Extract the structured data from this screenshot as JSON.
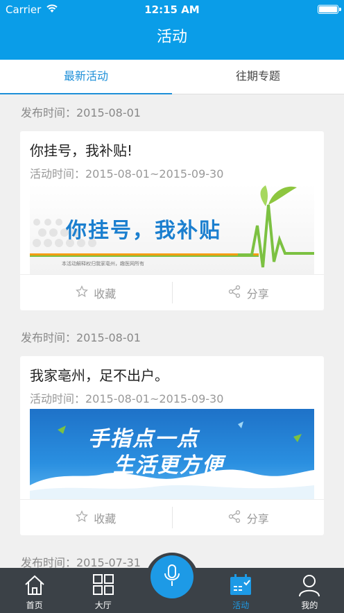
{
  "status": {
    "carrier": "Carrier",
    "time": "12:15 AM"
  },
  "nav": {
    "title": "活动"
  },
  "tabs": [
    {
      "label": "最新活动",
      "active": true
    },
    {
      "label": "往期专题",
      "active": false
    }
  ],
  "feed": [
    {
      "date": "发布时间：2015-08-01",
      "title": "你挂号，我补贴!",
      "time": "活动时间：2015-08-01~2015-09-30",
      "banner": {
        "headline": "你挂号，我补贴",
        "footnote": "本活动解释权归我家亳州，趣医网所有"
      },
      "favorite": "收藏",
      "share": "分享"
    },
    {
      "date": "发布时间：2015-08-01",
      "title": "我家亳州，足不出户。",
      "time": "活动时间：2015-08-01~2015-09-30",
      "banner": {
        "line1": "手指点一点",
        "line2": "生活更方便"
      },
      "favorite": "收藏",
      "share": "分享"
    },
    {
      "date": "发布时间：2015-07-31"
    }
  ],
  "tabbar": [
    {
      "label": "首页",
      "icon": "home-icon",
      "active": false
    },
    {
      "label": "大厅",
      "icon": "grid-icon",
      "active": false
    },
    {
      "label": "",
      "icon": "microphone-icon",
      "active": false
    },
    {
      "label": "活动",
      "icon": "calendar-icon",
      "active": true
    },
    {
      "label": "我的",
      "icon": "user-icon",
      "active": false
    }
  ],
  "colors": {
    "primary": "#0a9de8",
    "tabbar": "#3b4147",
    "active": "#1d9ae6"
  }
}
